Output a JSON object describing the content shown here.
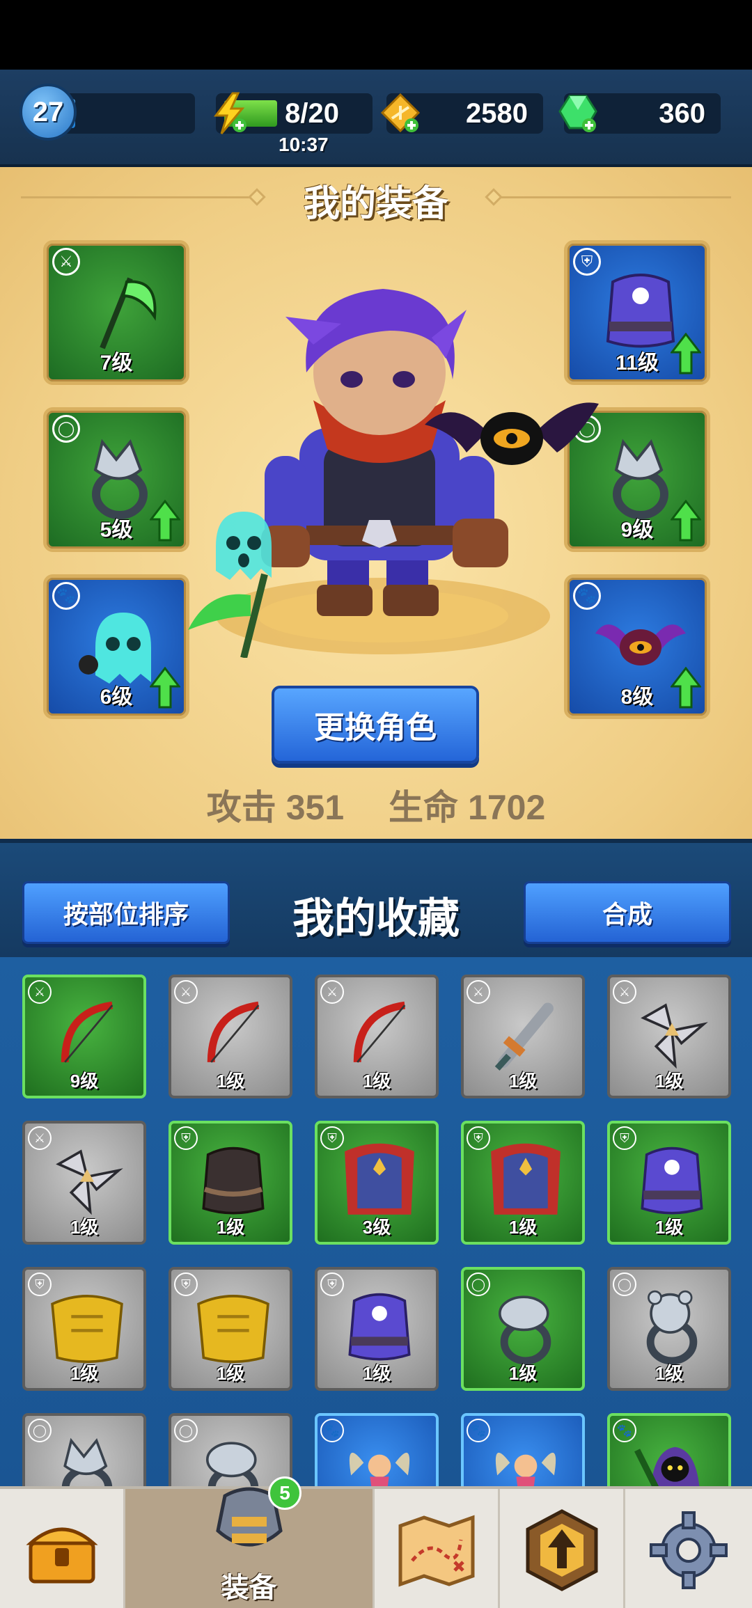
{
  "player": {
    "level": "27",
    "xp_fraction": 0.18
  },
  "energy": {
    "value": "8/20",
    "timer": "10:37",
    "fraction": 0.4
  },
  "gold": {
    "value": "2580"
  },
  "gems": {
    "value": "360"
  },
  "equipment_panel": {
    "title": "我的装备",
    "swap_button": "更换角色",
    "attack_label": "攻击",
    "attack_value": "351",
    "hp_label": "生命",
    "hp_value": "1702",
    "slots": [
      {
        "level": "7级",
        "type": "weapon",
        "rarity": "green",
        "icon": "scythe-icon",
        "upgrade": false
      },
      {
        "level": "5级",
        "type": "ring",
        "rarity": "green",
        "icon": "wolf-ring-icon",
        "upgrade": true
      },
      {
        "level": "6级",
        "type": "pet",
        "rarity": "blue",
        "icon": "ghost-pet-icon",
        "upgrade": true
      },
      {
        "level": "11级",
        "type": "armor",
        "rarity": "blue",
        "icon": "purple-armor-icon",
        "upgrade": true
      },
      {
        "level": "9级",
        "type": "ring",
        "rarity": "green",
        "icon": "wolf-ring-icon",
        "upgrade": true
      },
      {
        "level": "8级",
        "type": "pet",
        "rarity": "blue",
        "icon": "bat-pet-icon",
        "upgrade": true
      }
    ]
  },
  "collection": {
    "title": "我的收藏",
    "sort_button": "按部位排序",
    "merge_button": "合成",
    "items": [
      {
        "level": "9级",
        "type": "weapon",
        "rarity": "green",
        "icon": "bow-icon"
      },
      {
        "level": "1级",
        "type": "weapon",
        "rarity": "gray",
        "icon": "bow-icon"
      },
      {
        "level": "1级",
        "type": "weapon",
        "rarity": "gray",
        "icon": "bow-icon"
      },
      {
        "level": "1级",
        "type": "weapon",
        "rarity": "gray",
        "icon": "sword-icon"
      },
      {
        "level": "1级",
        "type": "weapon",
        "rarity": "gray",
        "icon": "shuriken-icon"
      },
      {
        "level": "1级",
        "type": "weapon",
        "rarity": "gray",
        "icon": "shuriken-icon"
      },
      {
        "level": "1级",
        "type": "armor",
        "rarity": "green",
        "icon": "dark-vest-icon"
      },
      {
        "level": "3级",
        "type": "armor",
        "rarity": "green",
        "icon": "red-cape-armor-icon"
      },
      {
        "level": "1级",
        "type": "armor",
        "rarity": "green",
        "icon": "red-cape-armor-icon"
      },
      {
        "level": "1级",
        "type": "armor",
        "rarity": "green",
        "icon": "purple-armor-icon"
      },
      {
        "level": "1级",
        "type": "armor",
        "rarity": "gray",
        "icon": "gold-armor-icon"
      },
      {
        "level": "1级",
        "type": "armor",
        "rarity": "gray",
        "icon": "gold-armor-icon"
      },
      {
        "level": "1级",
        "type": "armor",
        "rarity": "gray",
        "icon": "purple-armor-icon"
      },
      {
        "level": "1级",
        "type": "ring",
        "rarity": "green",
        "icon": "snake-ring-icon"
      },
      {
        "level": "1级",
        "type": "ring",
        "rarity": "gray",
        "icon": "bear-ring-icon"
      },
      {
        "level": "",
        "type": "ring",
        "rarity": "gray",
        "icon": "wolf-ring-icon"
      },
      {
        "level": "",
        "type": "ring",
        "rarity": "gray",
        "icon": "snake-ring-icon"
      },
      {
        "level": "",
        "type": "pet",
        "rarity": "blue",
        "icon": "fairy-pet-icon"
      },
      {
        "level": "",
        "type": "pet",
        "rarity": "blue",
        "icon": "fairy-pet-icon"
      },
      {
        "level": "",
        "type": "pet",
        "rarity": "green",
        "icon": "reaper-pet-icon"
      }
    ]
  },
  "nav": {
    "items": [
      {
        "icon": "chest-icon",
        "label": ""
      },
      {
        "icon": "armor-icon",
        "label": "装备",
        "badge": "5",
        "active": true
      },
      {
        "icon": "map-icon",
        "label": ""
      },
      {
        "icon": "upgrade-icon",
        "label": ""
      },
      {
        "icon": "gear-icon",
        "label": ""
      }
    ]
  },
  "colors": {
    "green_rarity": "#2f8f2c",
    "blue_rarity": "#2467d0",
    "gray_rarity": "#a9a9a9",
    "button_blue": "#2f7fe8",
    "panel_gold": "#f2d48c"
  }
}
